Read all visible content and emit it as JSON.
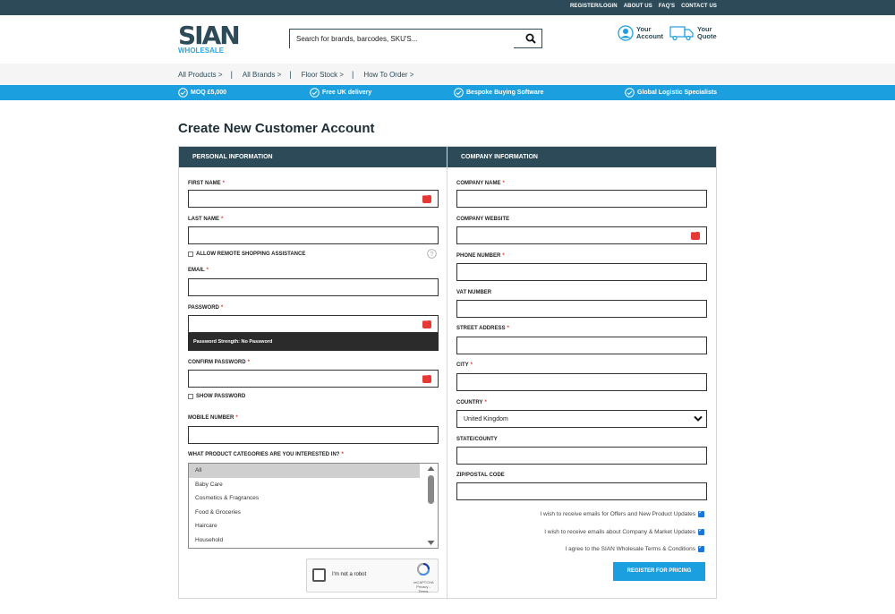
{
  "top_links": [
    "REGISTER/LOGIN",
    "ABOUT US",
    "FAQ'S",
    "CONTACT US"
  ],
  "logo": {
    "main": "SIAN",
    "sub": "WHOLESALE"
  },
  "search": {
    "placeholder": "Search for brands, barcodes, SKU'S..."
  },
  "header_links": {
    "account": {
      "line1": "Your",
      "line2": "Account"
    },
    "quote": {
      "line1": "Your",
      "line2": "Quote"
    }
  },
  "nav": [
    "All Products >",
    "All Brands >",
    "Floor Stock >",
    "How To Order >"
  ],
  "usp": [
    "MOQ £5,000",
    "Free UK delivery",
    "Bespoke Buying Software",
    "Global Logistic Specialists"
  ],
  "page_title": "Create New Customer Account",
  "personal": {
    "heading": "PERSONAL INFORMATION",
    "first_name": "FIRST NAME",
    "last_name": "LAST NAME",
    "remote_assist": "ALLOW REMOTE SHOPPING ASSISTANCE",
    "email": "EMAIL",
    "password": "PASSWORD",
    "strength": "Password Strength: No Password",
    "confirm_password": "CONFIRM PASSWORD",
    "show_password": "SHOW PASSWORD",
    "mobile": "MOBILE NUMBER",
    "categories_label": "WHAT PRODUCT CATEGORIES ARE YOU INTERESTED IN?",
    "categories": [
      "All",
      "Baby Care",
      "Cosmetics & Fragrances",
      "Food & Groceries",
      "Haircare",
      "Household"
    ],
    "selected_category": "All"
  },
  "captcha": {
    "text": "I'm not a robot",
    "brand": "reCAPTCHA",
    "links": "Privacy - Terms"
  },
  "company": {
    "heading": "COMPANY INFORMATION",
    "company_name": "COMPANY NAME",
    "company_website": "COMPANY WEBSITE",
    "phone": "PHONE NUMBER",
    "vat": "VAT NUMBER",
    "street": "STREET ADDRESS",
    "city": "CITY",
    "country": "COUNTRY",
    "country_value": "United Kingdom",
    "state": "STATE/COUNTY",
    "zip": "ZIP/POSTAL CODE"
  },
  "optins": [
    "I wish to receive emails for Offers and New Product Updates",
    "I wish to receive emails about Company & Market Updates",
    "I agree to the SIAN Wholesale Terms & Conditions"
  ],
  "submit_label": "REGISTER FOR PRICING",
  "colors": {
    "dark": "#2c4a57",
    "accent": "#1b9fde",
    "required": "#e53935"
  }
}
